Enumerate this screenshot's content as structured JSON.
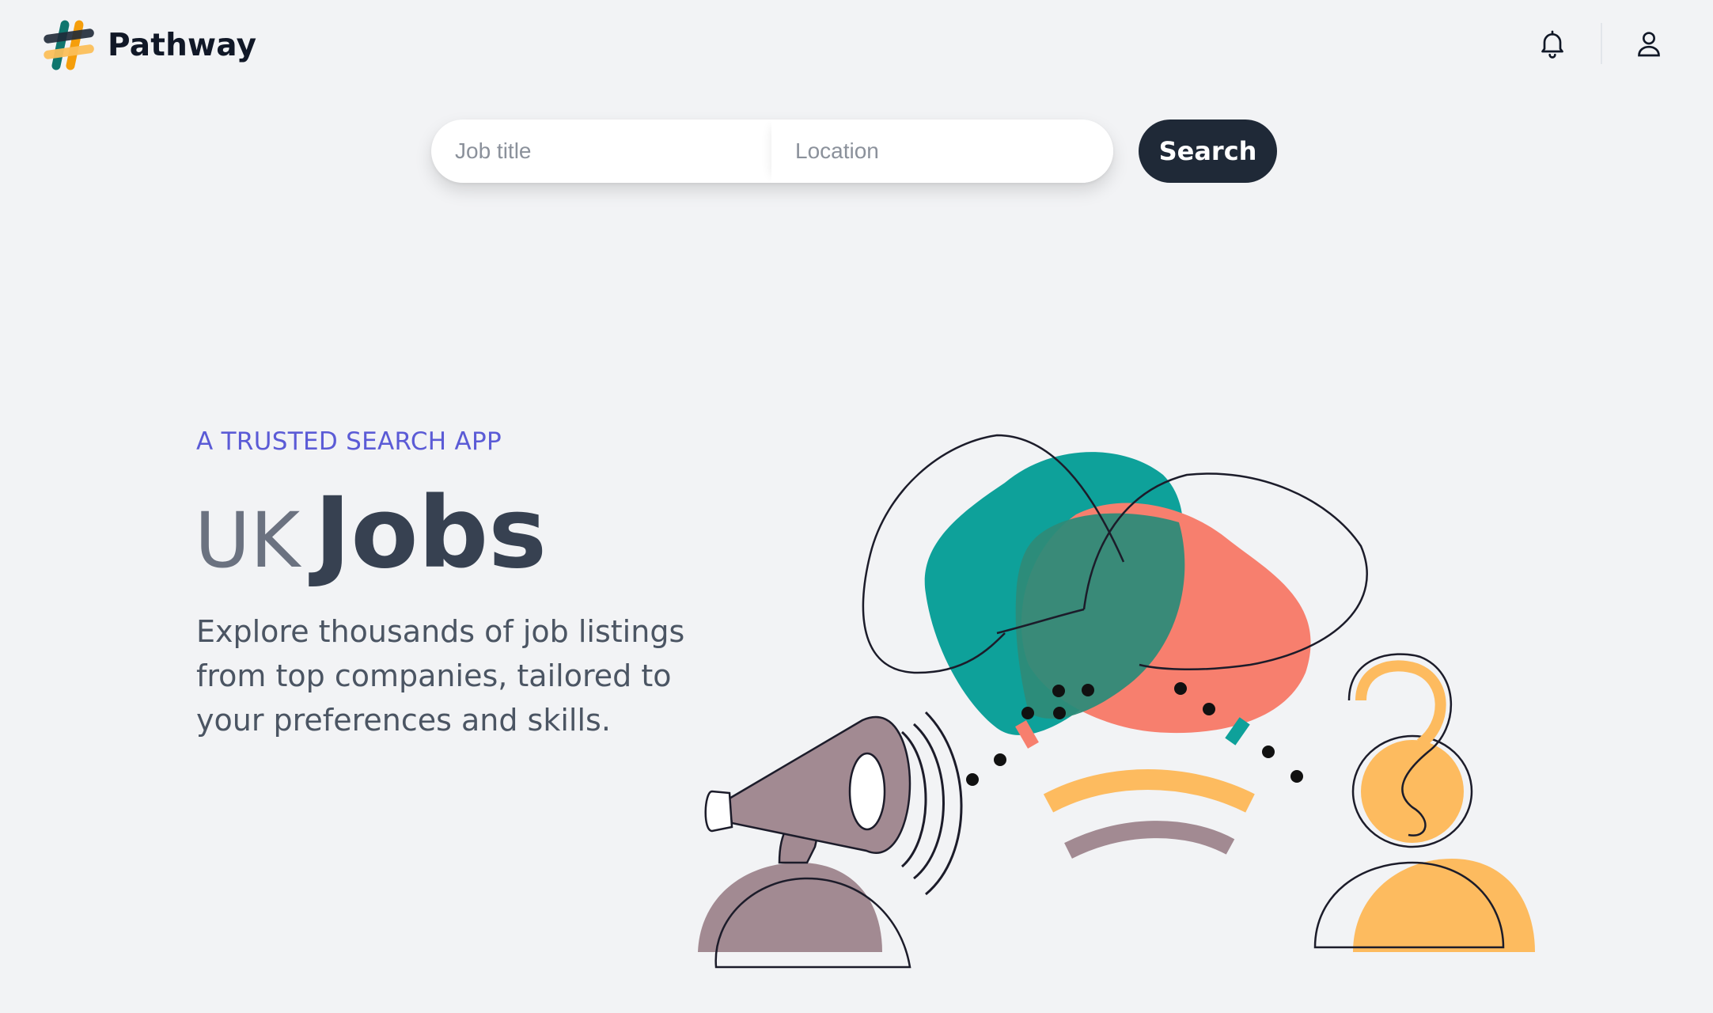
{
  "header": {
    "brand_name": "Pathway",
    "logo_icon": "hashtag-logo-icon",
    "notification_icon": "bell-icon",
    "profile_icon": "user-icon"
  },
  "search": {
    "job_title_placeholder": "Job title",
    "location_placeholder": "Location",
    "button_label": "Search"
  },
  "hero": {
    "eyebrow": "A TRUSTED SEARCH APP",
    "title_prefix": "UK",
    "title_main": "Jobs",
    "description": "Explore thousands of job listings from top companies, tailored to your preferences and skills."
  },
  "illustration": {
    "name": "megaphone-and-listener-illustration",
    "colors": {
      "teal": "#0ea19a",
      "coral": "#f77f6e",
      "mauve": "#a28a92",
      "yellow": "#fdbb5f",
      "ink": "#1c1c2a"
    }
  },
  "colors": {
    "background": "#f2f3f5",
    "accent": "#5b5bd6",
    "button": "#1f2937"
  }
}
